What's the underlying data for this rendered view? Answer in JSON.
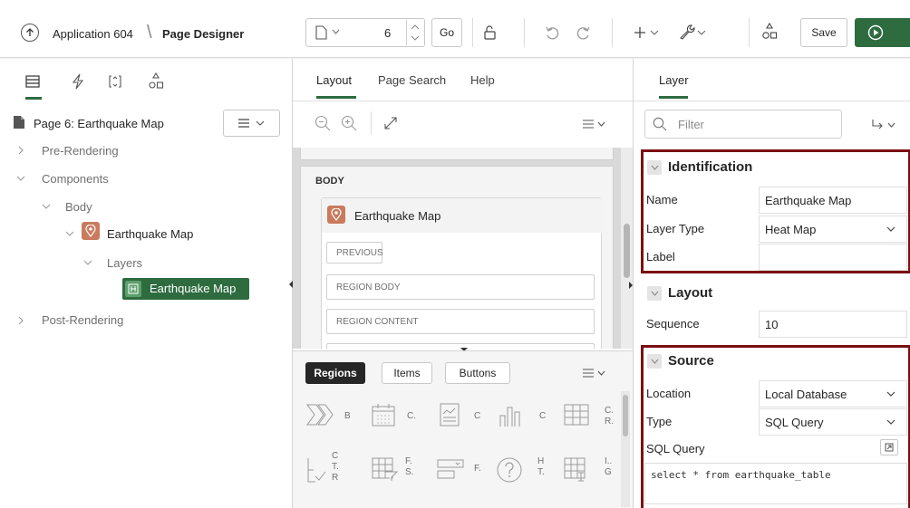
{
  "header": {
    "app_label": "Application 604",
    "page_designer_label": "Page Designer",
    "page_number": "6",
    "go_label": "Go",
    "save_label": "Save"
  },
  "left": {
    "page_title": "Page 6: Earthquake Map",
    "tree": {
      "pre_rendering": "Pre-Rendering",
      "components": "Components",
      "body": "Body",
      "region": "Earthquake Map",
      "layers": "Layers",
      "layer": "Earthquake Map",
      "post_rendering": "Post-Rendering"
    }
  },
  "middle": {
    "tabs": [
      "Layout",
      "Page Search",
      "Help"
    ],
    "body_label": "BODY",
    "region_title": "Earthquake Map",
    "slots": [
      "PREVIOUS",
      "REGION BODY",
      "REGION CONTENT"
    ],
    "gallery_tabs": [
      "Regions",
      "Items",
      "Buttons"
    ],
    "gallery": [
      [
        "B"
      ],
      [
        "C."
      ],
      [
        "C"
      ],
      [
        "C"
      ],
      [
        "C.",
        "R."
      ],
      [
        "C",
        "T.",
        "R"
      ],
      [
        "F.",
        "S."
      ],
      [
        "F."
      ],
      [
        "H",
        "T."
      ],
      [
        "I..",
        "G"
      ]
    ]
  },
  "right": {
    "tab": "Layer",
    "filter_placeholder": "Filter",
    "identification": {
      "title": "Identification",
      "name_label": "Name",
      "name_value": "Earthquake Map",
      "layer_type_label": "Layer Type",
      "layer_type_value": "Heat Map",
      "label_label": "Label",
      "label_value": ""
    },
    "layout": {
      "title": "Layout",
      "sequence_label": "Sequence",
      "sequence_value": "10"
    },
    "source": {
      "title": "Source",
      "location_label": "Location",
      "location_value": "Local Database",
      "type_label": "Type",
      "type_value": "SQL Query",
      "sql_label": "SQL Query",
      "sql_value": "select * from earthquake_table"
    }
  },
  "colors": {
    "accent_green": "#2e6b3f",
    "region_icon": "#c97b5e",
    "highlight_red": "#7a0f12"
  }
}
